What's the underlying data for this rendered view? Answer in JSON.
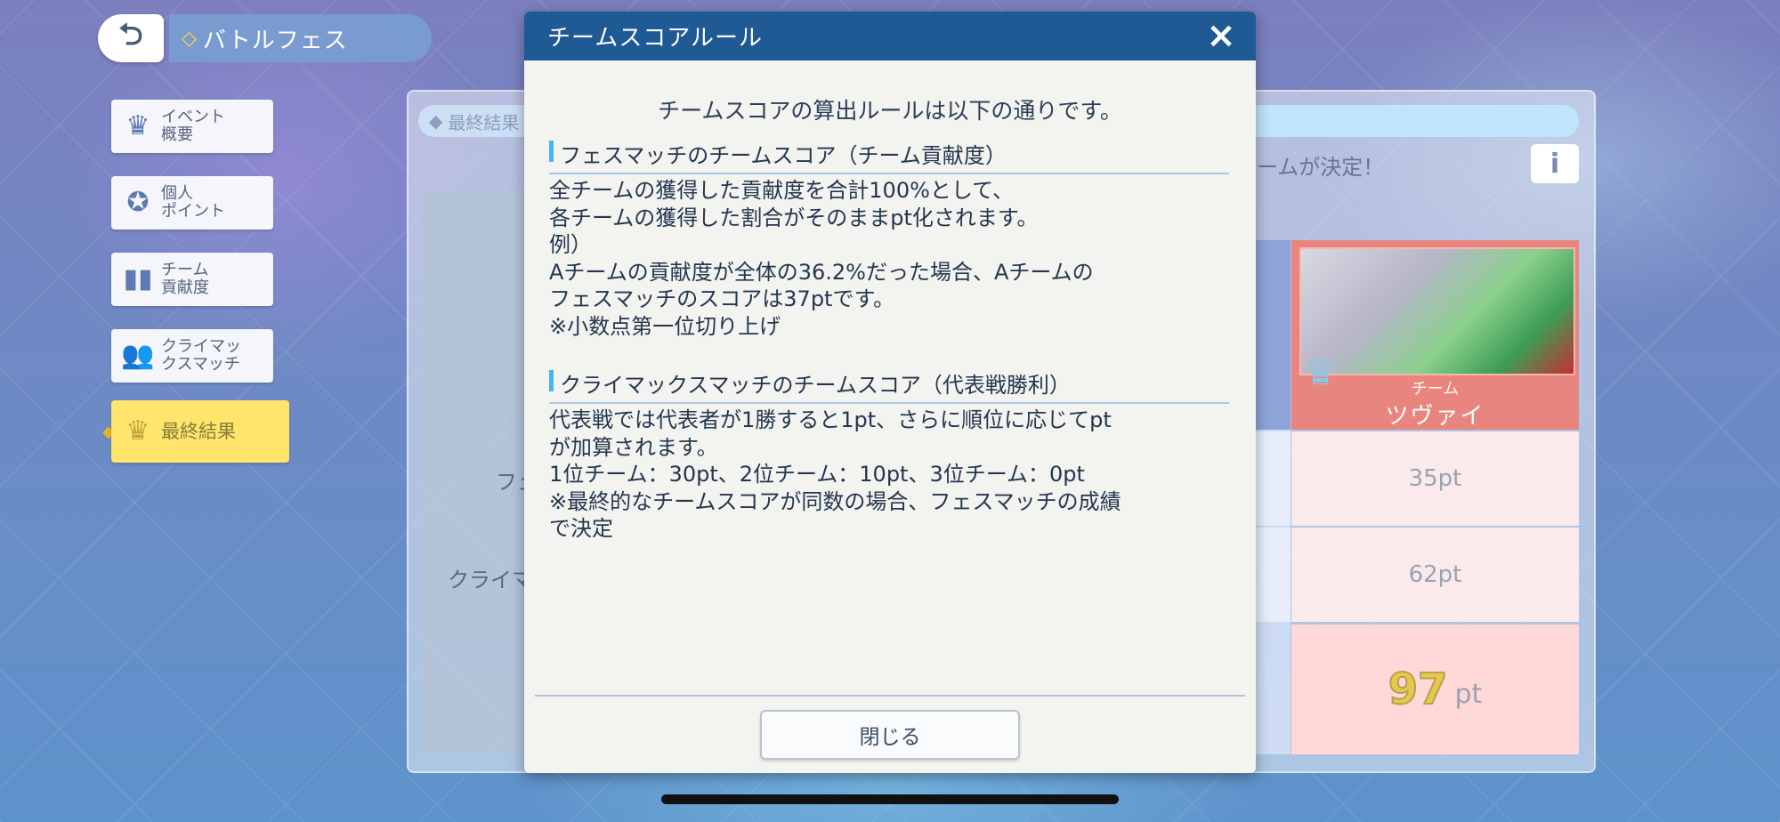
{
  "header": {
    "back_icon": "back-arrow-icon",
    "title": "バトルフェス"
  },
  "sidebar": {
    "items": [
      {
        "label_l1": "イベント",
        "label_l2": "概要",
        "icon": "crown-cluster-icon"
      },
      {
        "label_l1": "個人",
        "label_l2": "ポイント",
        "icon": "star-sparkle-icon"
      },
      {
        "label_l1": "チーム",
        "label_l2": "貢献度",
        "icon": "bars-icon"
      },
      {
        "label_l1": "クライマッ",
        "label_l2": "クスマッチ",
        "icon": "people-versus-icon"
      },
      {
        "label_l1": "最終結果",
        "label_l2": "",
        "icon": "trophy-crowns-icon",
        "active": true
      }
    ]
  },
  "background": {
    "tab_label": "最終結果",
    "decided_text": "ームが決定！",
    "info_label": "i",
    "row_labels": [
      "フェ",
      "クライマ"
    ],
    "team_small": "チーム",
    "team_name": "ツヴァイ",
    "scores": [
      "35pt",
      "62pt"
    ],
    "total_value": "97",
    "total_unit": "pt"
  },
  "modal": {
    "title": "チームスコアルール",
    "close_icon": "×",
    "intro": "チームスコアの算出ルールは以下の通りです。",
    "section1": {
      "title": "フェスマッチのチームスコア（チーム貢献度）",
      "lines": [
        "全チームの獲得した貢献度を合計100%として、",
        "各チームの獲得した割合がそのままpt化されます。",
        "例）",
        "Aチームの貢献度が全体の36.2%だった場合、Aチームの",
        "フェスマッチのスコアは37ptです。",
        "※小数点第一位切り上げ"
      ]
    },
    "section2": {
      "title": "クライマックスマッチのチームスコア（代表戦勝利）",
      "lines": [
        "代表戦では代表者が1勝すると1pt、さらに順位に応じてpt",
        "が加算されます。",
        "1位チーム：30pt、2位チーム：10pt、3位チーム：0pt",
        "※最終的なチームスコアが同数の場合、フェスマッチの成績",
        "で決定"
      ]
    },
    "close_button": "閉じる"
  },
  "colors": {
    "modal_header": "#1f5a95",
    "section_accent": "#48b6ee",
    "active_menu": "#ffe56b",
    "team_card": "#e9857f"
  }
}
